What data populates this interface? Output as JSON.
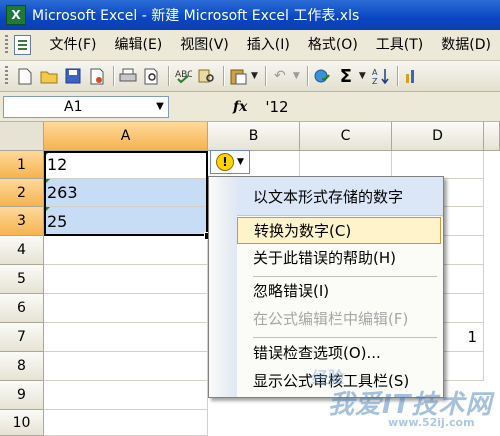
{
  "window": {
    "title": "Microsoft Excel - 新建 Microsoft Excel 工作表.xls"
  },
  "menu": {
    "items": [
      "文件(F)",
      "编辑(E)",
      "视图(V)",
      "插入(I)",
      "格式(O)",
      "工具(T)",
      "数据(D)"
    ]
  },
  "formula_bar": {
    "name_box": "A1",
    "fx": "fx",
    "formula": "'12"
  },
  "columns": [
    "A",
    "B",
    "C",
    "D"
  ],
  "rows": [
    "1",
    "2",
    "3",
    "4",
    "5",
    "6",
    "7",
    "8",
    "9",
    "10"
  ],
  "cells": {
    "A1": "12",
    "A2": "263",
    "A3": "25",
    "D7": "1"
  },
  "context_menu": {
    "title": "以文本形式存储的数字",
    "items": [
      "转换为数字(C)",
      "关于此错误的帮助(H)",
      "忽略错误(I)",
      "在公式编辑栏中编辑(F)",
      "错误检查选项(O)...",
      "显示公式审核工具栏(S)"
    ]
  },
  "watermark": {
    "brand": "我爱IT技术网",
    "url": "www.52ij.com",
    "top": "经验"
  }
}
